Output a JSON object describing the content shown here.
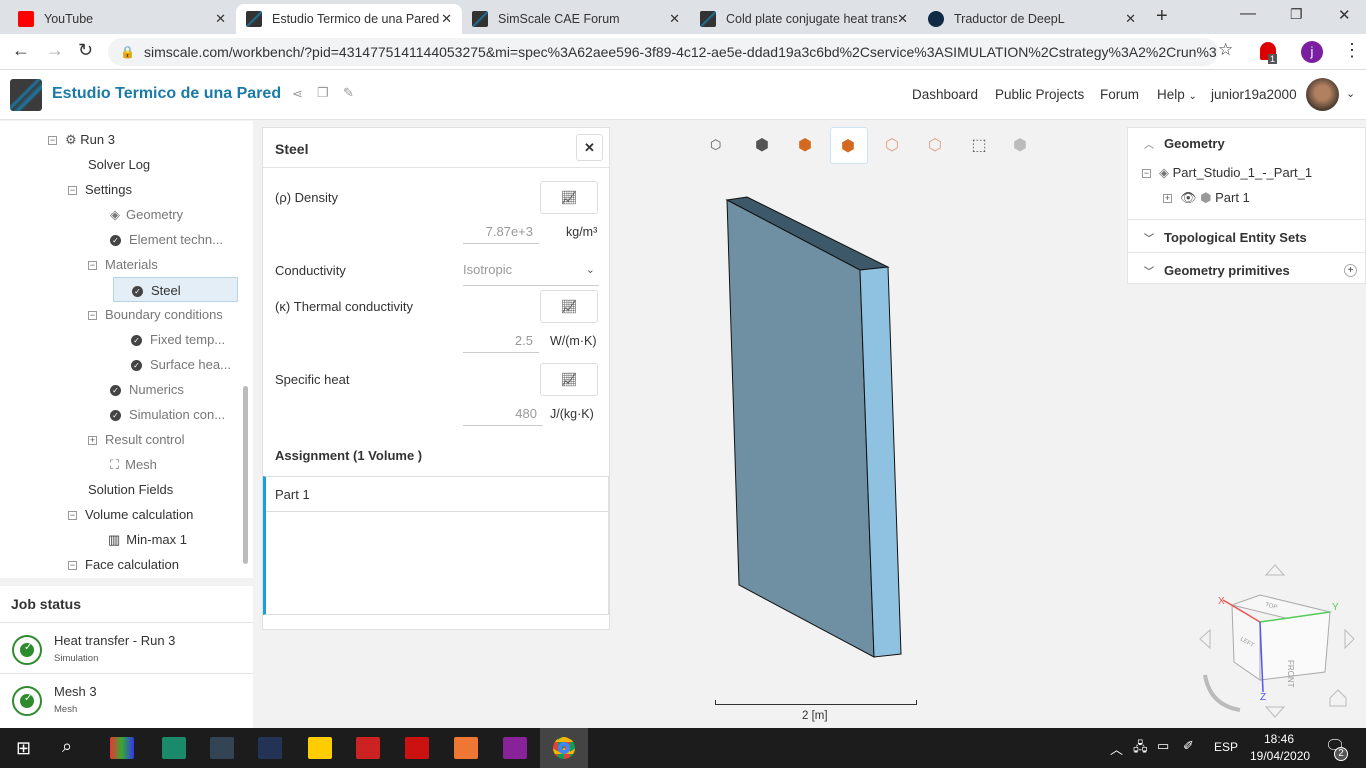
{
  "browser": {
    "tabs": [
      {
        "title": "YouTube"
      },
      {
        "title": "Estudio Termico de una Pared"
      },
      {
        "title": "SimScale CAE Forum"
      },
      {
        "title": "Cold plate conjugate heat trans"
      },
      {
        "title": "Traductor de DeepL"
      }
    ],
    "url": "simscale.com/workbench/?pid=4314775141144053275&mi=spec%3A62aee596-3f89-4c12-ae5e-ddad19a3c6bd%2Cservice%3ASIMULATION%2Cstrategy%3A2%2Crun%3...",
    "profile_initial": "j",
    "ext_badge": "1"
  },
  "header": {
    "title": "Estudio Termico de una Pared",
    "nav": [
      "Dashboard",
      "Public Projects",
      "Forum",
      "Help"
    ],
    "user": "junior19a2000"
  },
  "tree": [
    {
      "label": "Run 3"
    },
    {
      "label": "Solver Log"
    },
    {
      "label": "Settings"
    },
    {
      "label": "Geometry"
    },
    {
      "label": "Element techn..."
    },
    {
      "label": "Materials"
    },
    {
      "label": "Steel"
    },
    {
      "label": "Boundary conditions"
    },
    {
      "label": "Fixed temp..."
    },
    {
      "label": "Surface hea..."
    },
    {
      "label": "Numerics"
    },
    {
      "label": "Simulation con..."
    },
    {
      "label": "Result control"
    },
    {
      "label": "Mesh"
    },
    {
      "label": "Solution Fields"
    },
    {
      "label": "Volume calculation"
    },
    {
      "label": "Min-max 1"
    },
    {
      "label": "Face calculation"
    }
  ],
  "job_status": {
    "title": "Job status",
    "jobs": [
      {
        "name": "Heat transfer - Run 3",
        "type": "Simulation"
      },
      {
        "name": "Mesh 3",
        "type": "Mesh"
      }
    ]
  },
  "material": {
    "title": "Steel",
    "density_label": "(ρ) Density",
    "density": "7.87e+3",
    "density_unit": "kg/m³",
    "conductivity_label": "Conductivity",
    "conductivity_value": "Isotropic",
    "thermal_label": "(κ) Thermal conductivity",
    "thermal": "2.5",
    "thermal_unit": "W/(m·K)",
    "specific_label": "Specific heat",
    "specific": "480",
    "specific_unit": "J/(kg·K)",
    "assignment_label": "Assignment (1 Volume )",
    "assigned": "Part 1"
  },
  "right_panel": {
    "geometry": "Geometry",
    "part_studio": "Part_Studio_1_-_Part_1",
    "part": "Part 1",
    "topo": "Topological Entity Sets",
    "prims": "Geometry primitives"
  },
  "viewer": {
    "scale": "2 [m]",
    "cube_front": "FRONT",
    "cube_left": "LEFT",
    "cube_top": "TOP"
  },
  "taskbar": {
    "lang": "ESP",
    "time": "18:46",
    "date": "19/04/2020",
    "notifications": "2"
  }
}
